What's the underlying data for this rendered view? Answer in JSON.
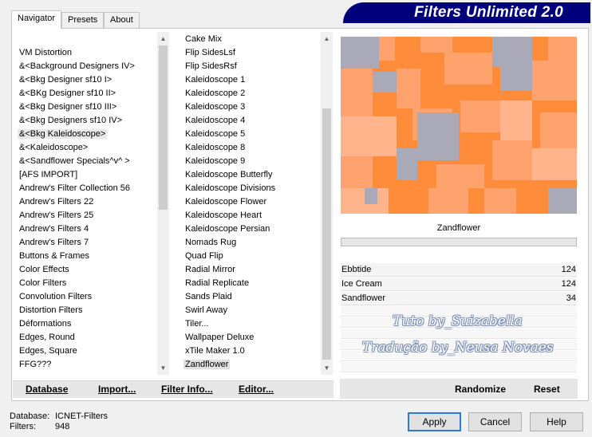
{
  "title": "Filters Unlimited 2.0",
  "tabs": [
    {
      "label": "Navigator",
      "active": true
    },
    {
      "label": "Presets",
      "active": false
    },
    {
      "label": "About",
      "active": false
    }
  ],
  "categories": [
    "VM Distortion",
    "&<Background Designers IV>",
    "&<Bkg Designer sf10 I>",
    "&<BKg Designer sf10 II>",
    "&<Bkg Designer sf10 III>",
    "&<Bkg Designers sf10 IV>",
    "&<Bkg Kaleidoscope>",
    "&<Kaleidoscope>",
    "&<Sandflower Specials^v^ >",
    "[AFS IMPORT]",
    "Andrew's Filter Collection 56",
    "Andrew's Filters 22",
    "Andrew's Filters 25",
    "Andrew's Filters 4",
    "Andrew's Filters 7",
    "Buttons & Frames",
    "Color Effects",
    "Color Filters",
    "Convolution Filters",
    "Distortion Filters",
    "Déformations",
    "Edges, Round",
    "Edges, Square",
    "FFG???"
  ],
  "selected_category": "&<Bkg Kaleidoscope>",
  "filters": [
    "Cake Mix",
    "Flip SidesLsf",
    "Flip SidesRsf",
    "Kaleidoscope 1",
    "Kaleidoscope 2",
    "Kaleidoscope 3",
    "Kaleidoscope 4",
    "Kaleidoscope 5",
    "Kaleidoscope 8",
    "Kaleidoscope 9",
    "Kaleidoscope Butterfly",
    "Kaleidoscope Divisions",
    "Kaleidoscope Flower",
    "Kaleidoscope Heart",
    "Kaleidoscope Persian",
    "Nomads Rug",
    "Quad Flip",
    "Radial Mirror",
    "Radial Replicate",
    "Sands Plaid",
    "Swirl Away",
    "Tiler...",
    "Wallpaper Deluxe",
    "xTile Maker 1.0",
    "Zandflower"
  ],
  "selected_filter": "Zandflower",
  "list_buttons": {
    "database": "Database",
    "import": "Import...",
    "filter_info": "Filter Info...",
    "editor": "Editor..."
  },
  "preview": {
    "filter_name": "Zandflower",
    "colors": {
      "orange": "#ff8c3a",
      "light_orange": "#ffa36e",
      "gray": "#a9a9b7",
      "pale": "#ffb48c"
    }
  },
  "parameters": [
    {
      "name": "Ebbtide",
      "value": "124"
    },
    {
      "name": "Ice Cream",
      "value": "124"
    },
    {
      "name": "Sandflower",
      "value": "34"
    }
  ],
  "watermark": {
    "line1": "Tuto by_Suizabella",
    "line2": "Tradução by_Neusa Novaes"
  },
  "preview_buttons": {
    "randomize": "Randomize",
    "reset": "Reset"
  },
  "status": {
    "database_label": "Database:",
    "database_value": "ICNET-Filters",
    "filters_label": "Filters:",
    "filters_value": "948"
  },
  "dialog_buttons": {
    "apply": "Apply",
    "cancel": "Cancel",
    "help": "Help"
  },
  "accent_color": "#00007a"
}
